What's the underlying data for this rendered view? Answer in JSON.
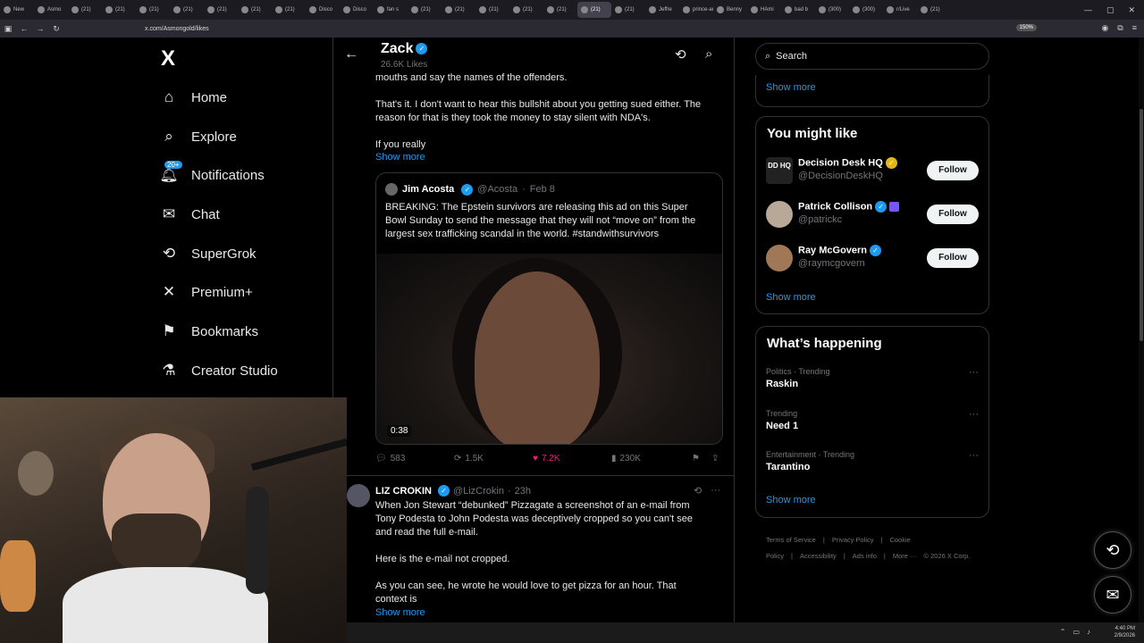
{
  "browser": {
    "tabs": [
      "New",
      "Asmo",
      "(21)",
      "(21)",
      "(21)",
      "(21)",
      "(21)",
      "(21)",
      "(21)",
      "Disco",
      "Disco",
      "fan s",
      "(21)",
      "(21)",
      "(21)",
      "(21)",
      "(21)",
      "(21)",
      "(21)",
      "Jeffre",
      "prince-an",
      "Benny",
      "HAmi",
      "bad b",
      "(300)",
      "(300)",
      "r/Live",
      "(21)"
    ],
    "active_tab_index": 17,
    "url": "x.com/Asmongold/likes",
    "zoom": "150%"
  },
  "sidebar": {
    "logo": "X",
    "items": [
      {
        "label": "Home",
        "icon": "home-icon"
      },
      {
        "label": "Explore",
        "icon": "search-icon"
      },
      {
        "label": "Notifications",
        "icon": "bell-icon",
        "badge": "20+"
      },
      {
        "label": "Chat",
        "icon": "mail-icon"
      },
      {
        "label": "SuperGrok",
        "icon": "grok-icon"
      },
      {
        "label": "Premium+",
        "icon": "x-icon"
      },
      {
        "label": "Bookmarks",
        "icon": "bookmark-icon"
      },
      {
        "label": "Creator Studio",
        "icon": "flask-icon"
      }
    ]
  },
  "header": {
    "name": "Zack",
    "likes": "26.6K Likes"
  },
  "tweet1": {
    "line_top": "mouths and say the names of the offenders.",
    "para2_line1": "That's it. I don't want to hear this bullshit about you getting sued either. The",
    "para2_line2": "reason for that is they took the money to stay silent with NDA's.",
    "para3": "If you really",
    "show_more": "Show more",
    "quote": {
      "name": "Jim Acosta",
      "handle": "@Acosta",
      "date": "Feb 8",
      "text_line1": "BREAKING: The Epstein survivors are releasing this ad on this Super",
      "text_line2": "Bowl Sunday to send the message that they will not “move on” from the",
      "text_line3": "largest sex trafficking scandal in the world. #standwithsurvivors",
      "video_duration": "0:38"
    },
    "actions": {
      "replies": "583",
      "reposts": "1.5K",
      "likes": "7.2K",
      "views": "230K"
    }
  },
  "tweet2": {
    "name": "LIZ CROKIN",
    "handle": "@LizCrokin",
    "time": "23h",
    "line1": "When Jon Stewart “debunked” Pizzagate a screenshot of an e-mail from",
    "line2": "Tony Podesta to John Podesta was deceptively cropped so you can't see",
    "line3": "and read the full e-mail.",
    "line4": "Here is the e-mail not cropped.",
    "line5": "As you can see, he wrote he would love to get pizza for an hour. That",
    "line6": "context is",
    "show_more": "Show more"
  },
  "right": {
    "search_placeholder": "Search",
    "top_show_more": "Show more",
    "wtf_title": "You might like",
    "wtf": [
      {
        "name": "Decision Desk HQ",
        "handle": "@DecisionDeskHQ",
        "avatar_text": "DD HQ",
        "follow": "Follow"
      },
      {
        "name": "Patrick Collison",
        "handle": "@patrickc",
        "follow": "Follow"
      },
      {
        "name": "Ray McGovern",
        "handle": "@raymcgovern",
        "follow": "Follow"
      }
    ],
    "wtf_show_more": "Show more",
    "trends_title": "What’s happening",
    "trends": [
      {
        "context": "Politics · Trending",
        "topic": "Raskin"
      },
      {
        "context": "Trending",
        "topic": "Need 1"
      },
      {
        "context": "Entertainment · Trending",
        "topic": "Tarantino"
      }
    ],
    "trends_show_more": "Show more",
    "footer": [
      "Terms of Service",
      "|",
      "Privacy Policy",
      "|",
      "Cookie Policy",
      "|",
      "Accessibility",
      "|",
      "Ads info",
      "|",
      "More ···",
      "© 2026 X Corp."
    ]
  },
  "taskbar": {
    "time": "4:40 PM",
    "date": "2/9/2026"
  },
  "colors": {
    "accent": "#1d9bf0",
    "like": "#f91880",
    "gold_check": "#e2b719"
  }
}
